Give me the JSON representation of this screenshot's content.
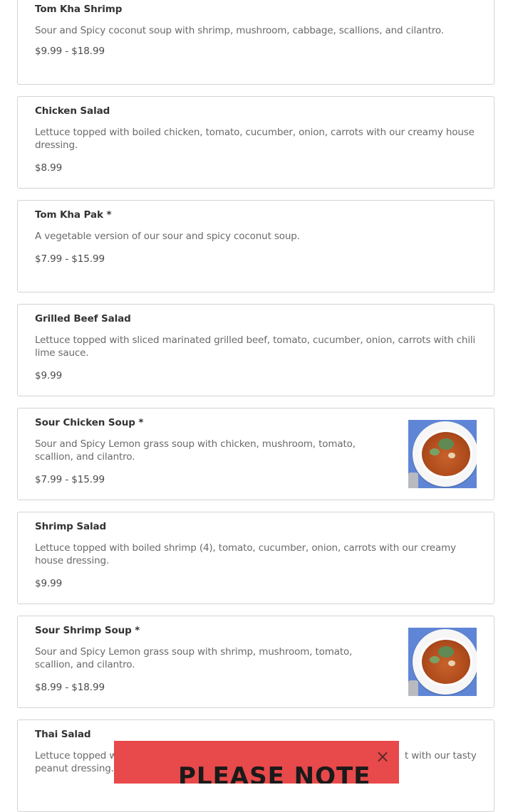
{
  "menu_items": [
    {
      "name": "Tom Kha Shrimp",
      "description": "Sour and Spicy coconut soup with shrimp, mushroom, cabbage, scallions, and cilantro.",
      "price": "$9.99 - $18.99"
    },
    {
      "name": "Chicken Salad",
      "description": "Lettuce topped with boiled chicken, tomato, cucumber, onion, carrots with our creamy house dressing.",
      "price": "$8.99"
    },
    {
      "name": "Tom Kha Pak *",
      "description": "A vegetable version of our sour and spicy coconut soup.",
      "price": "$7.99 - $15.99"
    },
    {
      "name": "Grilled Beef Salad",
      "description": "Lettuce topped with sliced marinated grilled beef, tomato, cucumber, onion, carrots with chili lime sauce.",
      "price": "$9.99"
    },
    {
      "name": "Sour Chicken Soup *",
      "description": "Sour and Spicy Lemon grass soup with chicken, mushroom, tomato, scallion, and cilantro.",
      "price": "$7.99 - $15.99"
    },
    {
      "name": "Shrimp Salad",
      "description": "Lettuce topped with boiled shrimp (4), tomato, cucumber, onion, carrots with our creamy house dressing.",
      "price": "$9.99"
    },
    {
      "name": "Sour Shrimp Soup *",
      "description": "Sour and Spicy Lemon grass soup with shrimp, mushroom, tomato, scallion, and cilantro.",
      "price": "$8.99 - $18.99"
    },
    {
      "name": "Thai Salad",
      "description": "Lettuce topped w... t with our tasty peanut dressing.",
      "description_visible_start": "Lettuce topped w",
      "description_visible_end": "t with our tasty",
      "description_line2": "peanut dressing."
    }
  ],
  "popup": {
    "title": "PLEASE NOTE",
    "close_label": "×",
    "background_color": "#e8494a"
  }
}
